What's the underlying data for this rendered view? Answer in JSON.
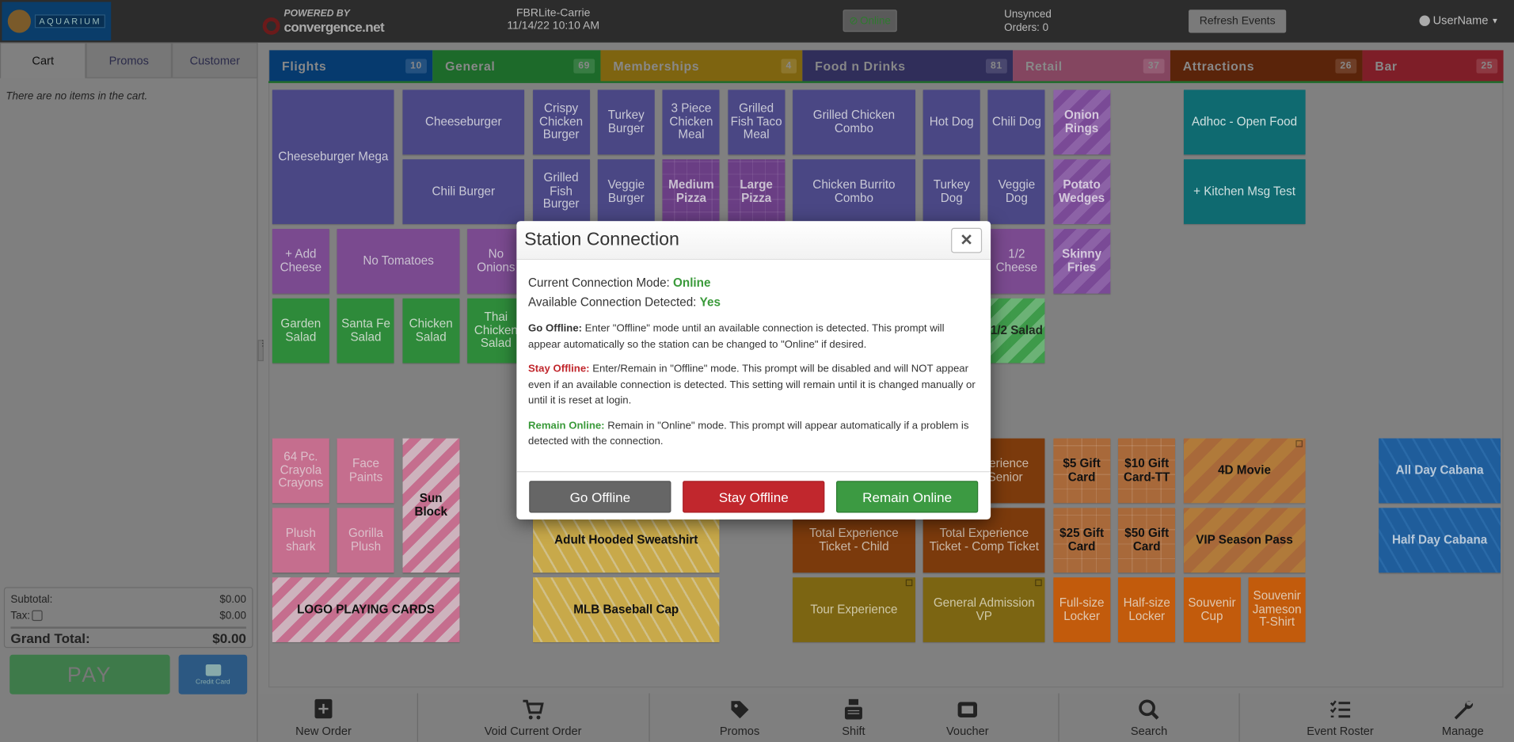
{
  "header": {
    "logo_text": "AQUARIUM",
    "powered_by": "POWERED BY",
    "brand": "convergence.net",
    "station_name": "FBRLite-Carrie",
    "datetime": "11/14/22 10:10 AM",
    "connection_status": "Online",
    "unsynced_line1": "Unsynced",
    "unsynced_line2": "Orders: 0",
    "refresh_label": "Refresh Events",
    "username": "UserName"
  },
  "sidebar": {
    "tabs": [
      "Cart",
      "Promos",
      "Customer"
    ],
    "active_tab": "Cart",
    "empty_message": "There are no items in the cart.",
    "subtotal_label": "Subtotal:",
    "subtotal_value": "$0.00",
    "tax_label": "Tax:",
    "tax_value": "$0.00",
    "grand_total_label": "Grand Total:",
    "grand_total_value": "$0.00",
    "pay_label": "PAY",
    "credit_card_label": "Credit Card"
  },
  "categories": [
    {
      "label": "Flights",
      "count": "10",
      "color": "#063a6e"
    },
    {
      "label": "General",
      "count": "69",
      "color": "#1d6a2a"
    },
    {
      "label": "Memberships",
      "count": "4",
      "color": "#7e6410"
    },
    {
      "label": "Food n Drinks",
      "count": "81",
      "color": "#302e5a"
    },
    {
      "label": "Retail",
      "count": "37",
      "color": "#844660"
    },
    {
      "label": "Attractions",
      "count": "26",
      "color": "#5a240a"
    },
    {
      "label": "Bar",
      "count": "25",
      "color": "#7e1e28"
    }
  ],
  "tiles": [
    {
      "label": "Cheeseburger Mega",
      "style": "food"
    },
    {
      "label": "Cheeseburger",
      "style": "food"
    },
    {
      "label": "Chili Burger",
      "style": "food"
    },
    {
      "label": "Crispy Chicken Burger",
      "style": "food"
    },
    {
      "label": "Grilled Fish Burger",
      "style": "food"
    },
    {
      "label": "Turkey Burger",
      "style": "food"
    },
    {
      "label": "Veggie Burger",
      "style": "food"
    },
    {
      "label": "3 Piece Chicken Meal",
      "style": "food"
    },
    {
      "label": "Medium Pizza",
      "style": "pizza"
    },
    {
      "label": "Grilled Fish Taco Meal",
      "style": "food"
    },
    {
      "label": "Large Pizza",
      "style": "pizza"
    },
    {
      "label": "Grilled Chicken Combo",
      "style": "food"
    },
    {
      "label": "Chicken Burrito Combo",
      "style": "food"
    },
    {
      "label": "Hot Dog",
      "style": "food"
    },
    {
      "label": "Turkey Dog",
      "style": "food"
    },
    {
      "label": "Chili Dog",
      "style": "food"
    },
    {
      "label": "Veggie Dog",
      "style": "food"
    },
    {
      "label": "Onion Rings",
      "style": "purple-stripe"
    },
    {
      "label": "Potato Wedges",
      "style": "purple-stripe"
    },
    {
      "label": "Skinny Fries",
      "style": "purple-stripe"
    },
    {
      "label": "Adhoc - Open Food",
      "style": "teal"
    },
    {
      "label": "+ Kitchen Msg Test",
      "style": "teal"
    },
    {
      "label": "+ Add Cheese",
      "style": "modifier"
    },
    {
      "label": "No Tomatoes",
      "style": "modifier"
    },
    {
      "label": "No Onions",
      "style": "modifier"
    },
    {
      "label": "1/2 Cheese",
      "style": "modifier"
    },
    {
      "label": "Garden Salad",
      "style": "salad"
    },
    {
      "label": "Santa Fe Salad",
      "style": "salad"
    },
    {
      "label": "Chicken Salad",
      "style": "salad"
    },
    {
      "label": "Thai Chicken Salad",
      "style": "salad"
    },
    {
      "label": "1/2 Salad",
      "style": "green-stripe"
    },
    {
      "label": "64 Pc. Crayola Crayons",
      "style": "pink"
    },
    {
      "label": "Face Paints",
      "style": "pink"
    },
    {
      "label": "Sun Block",
      "style": "pink-stripe"
    },
    {
      "label": "Plush shark",
      "style": "pink"
    },
    {
      "label": "Gorilla Plush",
      "style": "pink"
    },
    {
      "label": "LOGO PLAYING CARDS",
      "style": "pink-stripe"
    },
    {
      "label": "Adult Hooded Sweatshirt",
      "style": "yellow-chevron"
    },
    {
      "label": "MLB Baseball Cap",
      "style": "yellow-chevron"
    },
    {
      "label": "Total Experience Ticket - Senior",
      "style": "brown"
    },
    {
      "label": "Total Experience Ticket - Child",
      "style": "brown"
    },
    {
      "label": "Total Experience Ticket - Comp Ticket",
      "style": "brown"
    },
    {
      "label": "Tour Experience",
      "style": "olive",
      "popup": true
    },
    {
      "label": "General Admission VP",
      "style": "olive",
      "popup": true
    },
    {
      "label": "$5 Gift Card",
      "style": "gift"
    },
    {
      "label": "$10 Gift Card-TT",
      "style": "gift"
    },
    {
      "label": "$25 Gift Card",
      "style": "gift"
    },
    {
      "label": "$50 Gift Card",
      "style": "gift"
    },
    {
      "label": "4D Movie",
      "style": "orange-stripe",
      "popup": true
    },
    {
      "label": "VIP Season Pass",
      "style": "orange-stripe"
    },
    {
      "label": "Full-size Locker",
      "style": "orange"
    },
    {
      "label": "Half-size Locker",
      "style": "orange"
    },
    {
      "label": "Souvenir Cup",
      "style": "orange"
    },
    {
      "label": "Souvenir Jameson T-Shirt",
      "style": "orange"
    },
    {
      "label": "All Day Cabana",
      "style": "blue-chevron"
    },
    {
      "label": "Half Day Cabana",
      "style": "blue-chevron"
    }
  ],
  "modal": {
    "title": "Station Connection",
    "close_label": "✕",
    "mode_label": "Current Connection Mode:",
    "mode_value": "Online",
    "detected_label": "Available Connection Detected:",
    "detected_value": "Yes",
    "go_offline_title": "Go Offline:",
    "go_offline_text": "Enter \"Offline\" mode until an available connection is detected. This prompt will appear automatically so the station can be changed to \"Online\" if desired.",
    "stay_offline_title": "Stay Offline:",
    "stay_offline_text": "Enter/Remain in \"Offline\" mode. This prompt will be disabled and will NOT appear even if an available connection is detected. This setting will remain until it is changed manually or until it is reset at login.",
    "remain_online_title": "Remain Online:",
    "remain_online_text": "Remain in \"Online\" mode. This prompt will appear automatically if a problem is detected with the connection.",
    "buttons": {
      "go_offline": "Go Offline",
      "stay_offline": "Stay Offline",
      "remain_online": "Remain Online"
    },
    "colors": {
      "online": "#3a9a3a",
      "stay_offline": "#c1272d",
      "go_offline": "#666666"
    }
  },
  "toolbar": {
    "items": [
      {
        "label": "New Order",
        "icon": "plus-square-icon"
      },
      {
        "label": "Void Current Order",
        "icon": "cart-icon"
      },
      {
        "label": "Promos",
        "icon": "tag-icon"
      },
      {
        "label": "Shift",
        "icon": "cash-register-icon"
      },
      {
        "label": "Voucher",
        "icon": "ticket-icon"
      },
      {
        "label": "Search",
        "icon": "search-icon"
      },
      {
        "label": "Event Roster",
        "icon": "checklist-icon"
      },
      {
        "label": "Manage",
        "icon": "wrench-icon"
      }
    ]
  }
}
